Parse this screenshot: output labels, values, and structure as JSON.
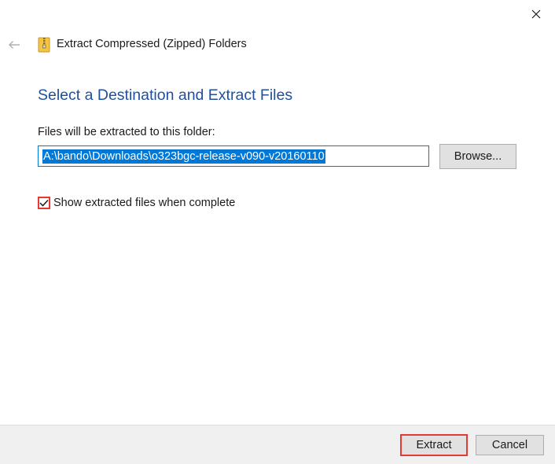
{
  "window": {
    "title": "Extract Compressed (Zipped) Folders",
    "close_icon": "close-icon",
    "back_icon": "back-arrow-icon",
    "app_icon": "zip-folder-icon"
  },
  "main": {
    "heading": "Select a Destination and Extract Files",
    "destination_label": "Files will be extracted to this folder:",
    "destination_value": "A:\\bando\\Downloads\\o323bgc-release-v090-v20160110",
    "browse_label": "Browse...",
    "show_files_label": "Show extracted files when complete",
    "show_files_checked": true
  },
  "footer": {
    "extract_label": "Extract",
    "cancel_label": "Cancel"
  },
  "colors": {
    "heading": "#1f4f9e",
    "selection": "#0078d7",
    "highlight_border": "#e53935"
  }
}
